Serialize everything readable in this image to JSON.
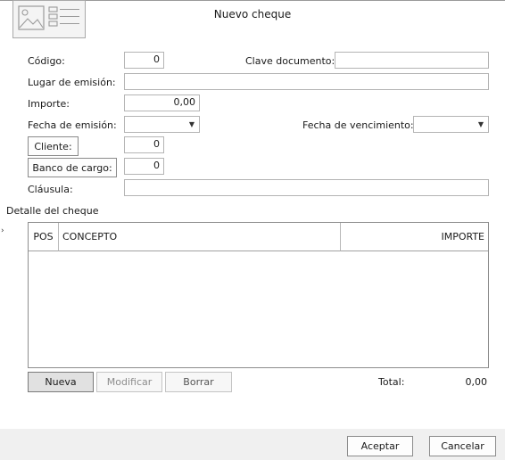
{
  "window": {
    "title": "Nuevo cheque"
  },
  "form": {
    "codigo_label": "Código:",
    "codigo_value": "0",
    "clave_label": "Clave documento:",
    "clave_value": "",
    "lugar_label": "Lugar de emisión:",
    "lugar_value": "",
    "importe_label": "Importe:",
    "importe_value": "0,00",
    "fecha_emision_label": "Fecha de emisión:",
    "fecha_emision_value": "",
    "fecha_venc_label": "Fecha de vencimiento:",
    "fecha_venc_value": "",
    "cliente_button": "Cliente:",
    "cliente_value": "0",
    "banco_button": "Banco de cargo:",
    "banco_value": "0",
    "clausula_label": "Cláusula:",
    "clausula_value": ""
  },
  "detail": {
    "section_title": "Detalle del cheque",
    "columns": [
      "POS",
      "CONCEPTO",
      "IMPORTE"
    ],
    "rows": []
  },
  "detail_buttons": {
    "nueva": "Nueva",
    "modificar": "Modificar",
    "borrar": "Borrar"
  },
  "total": {
    "label": "Total:",
    "value": "0,00"
  },
  "footer": {
    "accept": "Aceptar",
    "cancel": "Cancelar"
  },
  "icons": {
    "logo": "document-image-icon",
    "dropdown": "chevron-down-icon",
    "row_indicator": "chevron-right-icon"
  }
}
